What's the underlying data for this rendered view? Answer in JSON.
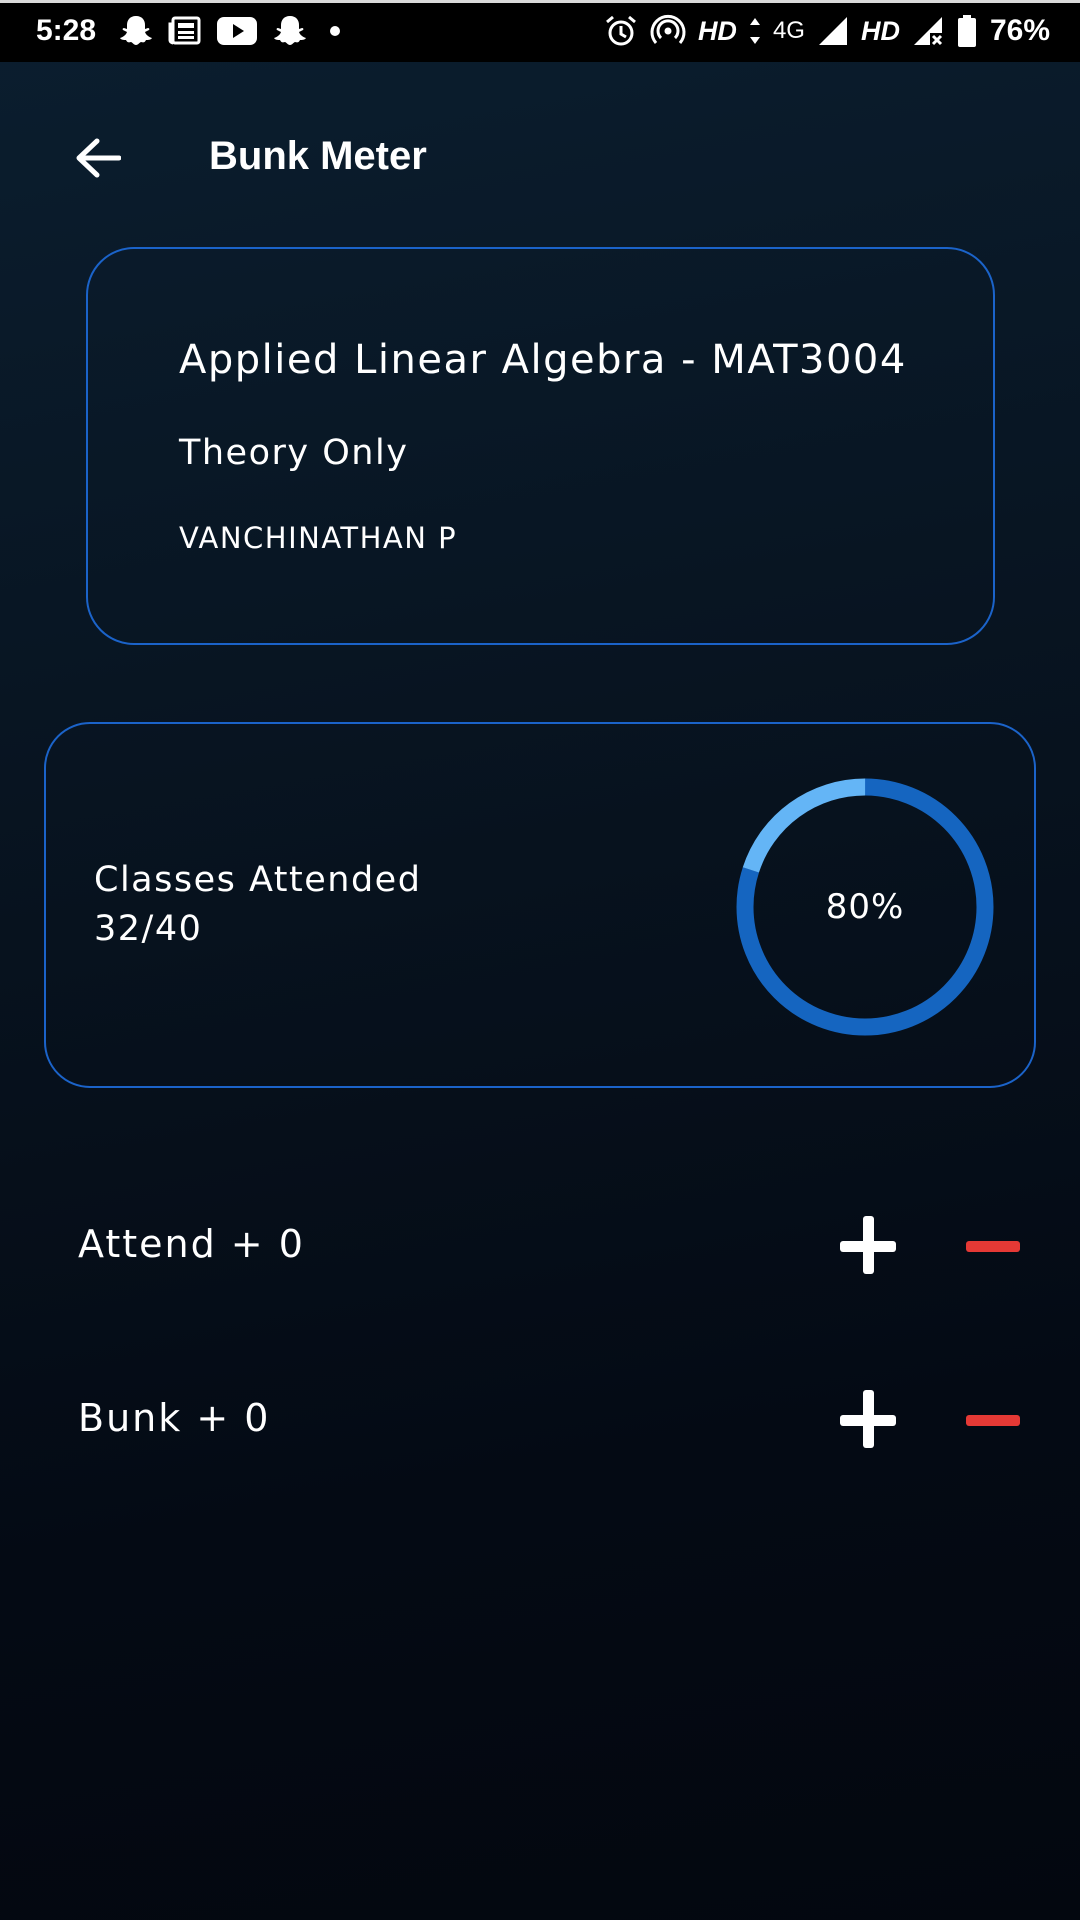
{
  "status_bar": {
    "time": "5:28",
    "hd_1": "HD",
    "network": "4G",
    "hd_2": "HD",
    "battery": "76%",
    "left_icons": [
      "snapchat-icon",
      "news-icon",
      "youtube-icon",
      "snapchat-icon",
      "dot-icon"
    ],
    "right_icons": [
      "alarm-icon",
      "hotspot-icon",
      "data-arrows-icon",
      "signal-icon",
      "signal-no-data-icon",
      "battery-icon"
    ]
  },
  "header": {
    "back_icon": "arrow-left-icon",
    "title": "Bunk Meter"
  },
  "course": {
    "name": "Applied Linear Algebra - MAT3004",
    "type": "Theory Only",
    "faculty": "VANCHINATHAN P"
  },
  "attendance": {
    "label": "Classes Attended",
    "count": "32/40",
    "percent_text": "80%",
    "fraction": 0.8
  },
  "counters": [
    {
      "label": "Attend + 0",
      "plus_icon": "plus-icon",
      "minus_icon": "minus-icon"
    },
    {
      "label": "Bunk + 0",
      "plus_icon": "plus-icon",
      "minus_icon": "minus-icon"
    }
  ],
  "colors": {
    "accent": "#1b63c9",
    "ring_main": "#1565c0",
    "ring_highlight": "#64b5f6",
    "minus": "#e53935",
    "background": "#07121e"
  }
}
